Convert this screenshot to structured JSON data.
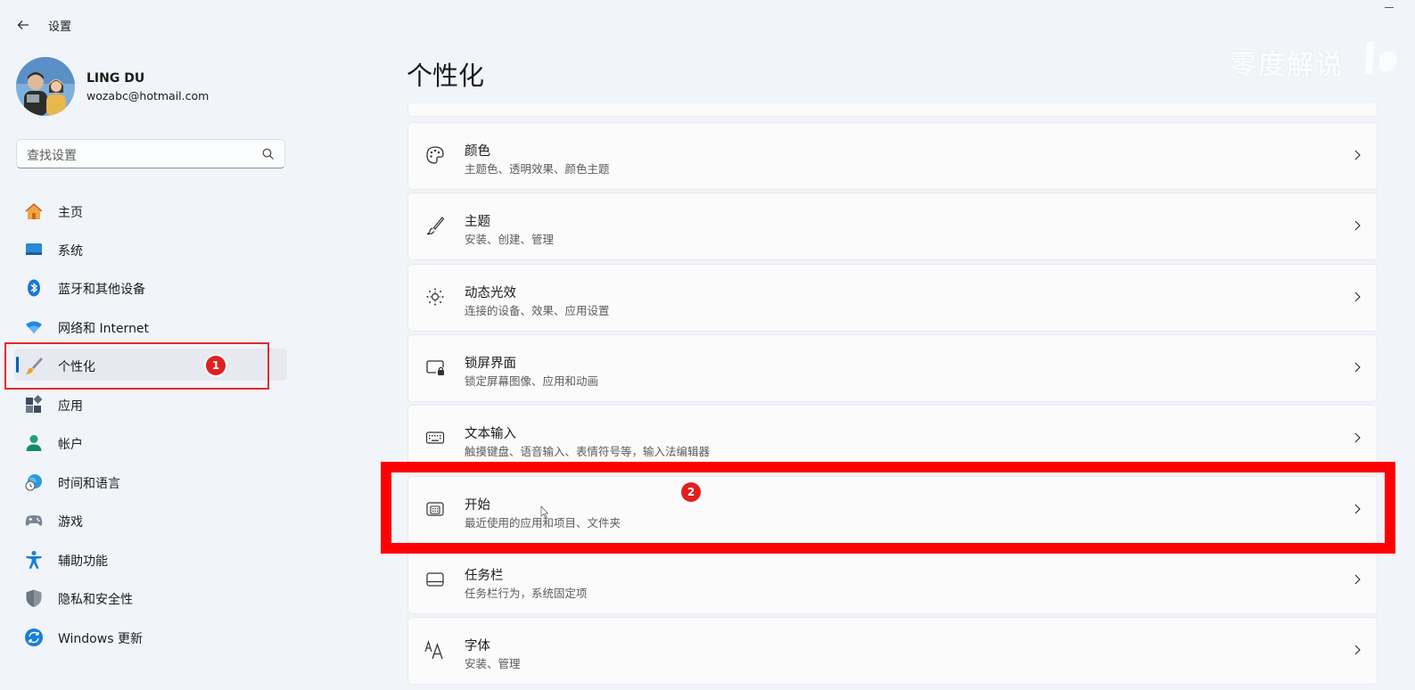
{
  "window": {
    "title": "设置",
    "watermark": "零度解说"
  },
  "profile": {
    "name": "LING DU",
    "email": "wozabc@hotmail.com"
  },
  "search": {
    "placeholder": "查找设置"
  },
  "sidebar": {
    "items": [
      {
        "label": "主页",
        "icon": "home-icon"
      },
      {
        "label": "系统",
        "icon": "system-icon"
      },
      {
        "label": "蓝牙和其他设备",
        "icon": "bluetooth-icon"
      },
      {
        "label": "网络和 Internet",
        "icon": "wifi-icon"
      },
      {
        "label": "个性化",
        "icon": "brush-icon",
        "selected": true
      },
      {
        "label": "应用",
        "icon": "apps-icon"
      },
      {
        "label": "帐户",
        "icon": "account-icon"
      },
      {
        "label": "时间和语言",
        "icon": "time-language-icon"
      },
      {
        "label": "游戏",
        "icon": "gamepad-icon"
      },
      {
        "label": "辅助功能",
        "icon": "accessibility-icon"
      },
      {
        "label": "隐私和安全性",
        "icon": "shield-icon"
      },
      {
        "label": "Windows 更新",
        "icon": "update-icon"
      }
    ]
  },
  "main": {
    "title": "个性化",
    "cards": [
      {
        "title": "颜色",
        "subtitle": "主题色、透明效果、颜色主题",
        "icon": "palette-icon"
      },
      {
        "title": "主题",
        "subtitle": "安装、创建、管理",
        "icon": "brush-icon"
      },
      {
        "title": "动态光效",
        "subtitle": "连接的设备、效果、应用设置",
        "icon": "dynamic-lighting-icon"
      },
      {
        "title": "锁屏界面",
        "subtitle": "锁定屏幕图像、应用和动画",
        "icon": "lock-screen-icon"
      },
      {
        "title": "文本输入",
        "subtitle": "触摸键盘、语音输入、表情符号等，输入法编辑器",
        "icon": "keyboard-icon"
      },
      {
        "title": "开始",
        "subtitle": "最近使用的应用和项目、文件夹",
        "icon": "start-menu-icon"
      },
      {
        "title": "任务栏",
        "subtitle": "任务栏行为，系统固定项",
        "icon": "taskbar-icon"
      },
      {
        "title": "字体",
        "subtitle": "安装、管理",
        "icon": "font-icon"
      }
    ]
  },
  "annotations": {
    "badge1": "1",
    "badge2": "2"
  },
  "colors": {
    "accent": "#005fb8",
    "annotation_red": "#ff0000"
  }
}
